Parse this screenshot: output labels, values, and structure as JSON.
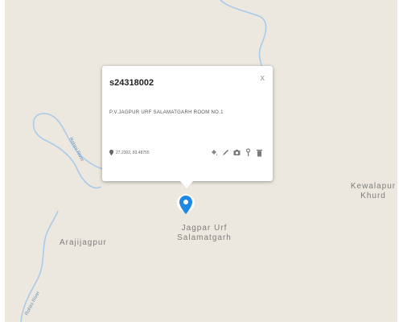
{
  "map": {
    "places": [
      {
        "id": "arajijagpur",
        "label": "Arajijagpur"
      },
      {
        "id": "kewalapur",
        "label": "Kewalapur Khurd"
      },
      {
        "id": "jagpur",
        "label": "Jagpar Urf Salamatgarh"
      }
    ],
    "rivers": [
      {
        "label": "Rohini River"
      },
      {
        "label": "Rohini River"
      }
    ],
    "colors": {
      "land": "#ece8df",
      "river": "#a9cbe9",
      "marker": "#1e88e5"
    }
  },
  "popup": {
    "title": "s24318002",
    "address": "P.V.JAGPUR URF SALAMATGARH ROOM NO.1",
    "coords": "27.2302, 83.48755",
    "close_icon": "x",
    "actions": [
      "paint-bucket-icon",
      "pencil-icon",
      "camera-icon",
      "key-icon",
      "trash-icon"
    ]
  }
}
